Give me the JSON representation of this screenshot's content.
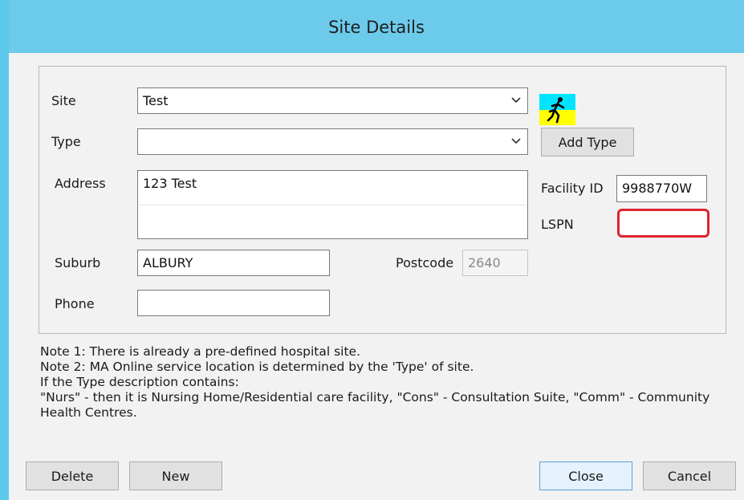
{
  "window": {
    "title": "Site Details"
  },
  "form": {
    "site": {
      "label": "Site",
      "value": "Test"
    },
    "type": {
      "label": "Type",
      "value": ""
    },
    "add_type_label": "Add Type",
    "address": {
      "label": "Address",
      "value": "123 Test"
    },
    "facility_id": {
      "label": "Facility ID",
      "value": "9988770W"
    },
    "lspn": {
      "label": "LSPN",
      "value": ""
    },
    "suburb": {
      "label": "Suburb",
      "value": "ALBURY"
    },
    "postcode": {
      "label": "Postcode",
      "value": "2640"
    },
    "phone": {
      "label": "Phone",
      "value": ""
    }
  },
  "notes": [
    "Note 1: There is already a pre-defined hospital site.",
    "Note 2: MA Online service location is determined by the 'Type' of site.",
    "If the Type description contains:",
    "\"Nurs\" - then it is Nursing Home/Residential care facility, \"Cons\" - Consultation Suite, \"Comm\" - Community Health Centres."
  ],
  "buttons": {
    "delete": "Delete",
    "new": "New",
    "close": "Close",
    "cancel": "Cancel"
  },
  "colors": {
    "title_bar": "#6ccbeb",
    "highlight": "#e0242d",
    "runner_top": "#00e5ff",
    "runner_bottom": "#ffff00"
  }
}
